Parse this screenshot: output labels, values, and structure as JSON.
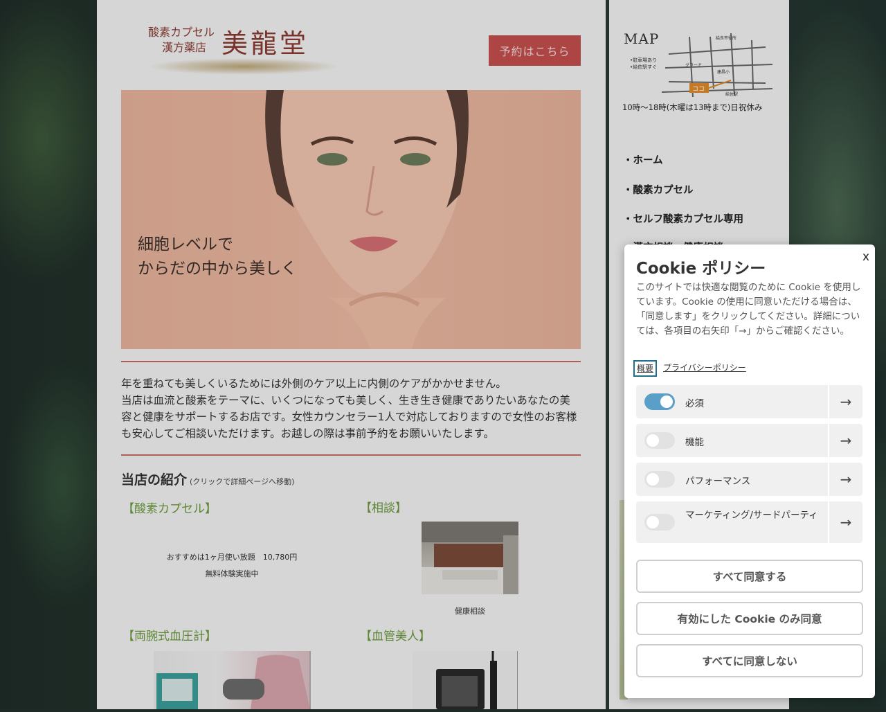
{
  "header": {
    "logo_sub_line1": "酸素カプセル",
    "logo_sub_line2": "漢方薬店",
    "logo_name": "美龍堂",
    "reserve_button": "予約はこちら"
  },
  "hero": {
    "line1": "細胞レベルで",
    "line2": "からだの中から美しく"
  },
  "intro": {
    "line1": "年を重ねても美しくいるためには外側のケア以上に内側のケアがかかせません。",
    "line2": "当店は血流と酸素をテーマに、いくつになっても美しく、生き生き健康でありたいあなたの美容と健康をサポートするお店です。女性カウンセラー1人で対応しておりますので女性のお客様も安心してご相談いただけます。お越しの際は事前予約をお願いいたします。"
  },
  "shop_intro": {
    "title": "当店の紹介",
    "note": "(クリックで詳細ページへ移動)",
    "items": [
      {
        "heading": "【酸素カプセル】",
        "text1": "おすすめは1ヶ月使い放題　10,780円",
        "text2": "無料体験実施中"
      },
      {
        "heading": "【相談】",
        "caption": "健康相談"
      },
      {
        "heading": "【両腕式血圧計】"
      },
      {
        "heading": "【血管美人】"
      }
    ]
  },
  "sidebar": {
    "map_title": "MAP",
    "map_labels": [
      "給良市役所",
      "グラード",
      "建昌小",
      "ココ",
      "•駐車場あり",
      "•給佐駅すぐ",
      "給佐駅"
    ],
    "hours": "10時～18時(木曜は13時まで)日祝休み",
    "nav": [
      "・ホーム",
      "・酸素カプセル",
      "・セルフ酸素カプセル専用",
      "・漢方相談・健康相談"
    ]
  },
  "cookie": {
    "close": "x",
    "title": "Cookie ポリシー",
    "description": "このサイトでは快適な閲覧のために Cookie を使用しています。Cookie の使用に同意いただける場合は、「同意します」をクリックしてください。詳細については、各項目の右矢印「→」からご確認ください。",
    "link_overview": "概要",
    "link_privacy": "プライバシーポリシー",
    "categories": [
      {
        "label": "必須",
        "enabled": true
      },
      {
        "label": "機能",
        "enabled": false
      },
      {
        "label": "パフォーマンス",
        "enabled": false
      },
      {
        "label": "マーケティング/サードパーティ",
        "enabled": false
      }
    ],
    "arrow": "→",
    "buttons": {
      "accept_all": "すべて同意する",
      "accept_enabled": "有効にした Cookie のみ同意",
      "reject_all": "すべてに同意しない"
    }
  },
  "colors": {
    "accent_red": "#c74f4f",
    "heading_green": "#6a9a3c",
    "toggle_on": "#5a9fc7",
    "logo": "#8a3b32"
  }
}
